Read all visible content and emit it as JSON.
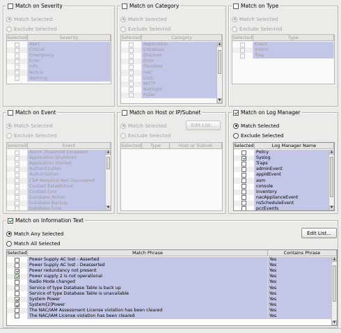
{
  "severity": {
    "title": "Match on Severity",
    "enabled": false,
    "match_selected": "Match Selected",
    "exclude_selected": "Exclude Selected",
    "col_selected": "Selected",
    "col_name": "Severity",
    "items": [
      "Alert",
      "Critical",
      "Emergency",
      "Error",
      "Info",
      "Notice",
      "Warning"
    ]
  },
  "category": {
    "title": "Match on Category",
    "enabled": false,
    "match_selected": "Match Selected",
    "exclude_selected": "Exclude Selected",
    "col_selected": "Selected",
    "col_name": "Category",
    "items": [
      "Application",
      "Database",
      "Discover",
      "Error",
      "FlexView",
      "HAC",
      "Lock",
      "MSTP",
      "NetSight",
      "Poller"
    ]
  },
  "type": {
    "title": "Match on Type",
    "enabled": false,
    "match_selected": "Match Selected",
    "exclude_selected": "Exclude Selected",
    "col_selected": "Selected",
    "col_name": "Type",
    "items": [
      "Event",
      "Inform",
      "Trap"
    ]
  },
  "event": {
    "title": "Match on Event",
    "enabled": false,
    "match_selected": "Match Selected",
    "exclude_selected": "Exclude Selected",
    "col_selected": "Selected",
    "col_name": "Event",
    "items": [
      "Alarm Threshold Exceeded",
      "Application Shutdown",
      "Application Started",
      "Authentication",
      "Authorization",
      "CDP Neighbor Not Discovered",
      "Contact Established",
      "Contact Lost",
      "Database Action",
      "Database Backup",
      "Database Error"
    ]
  },
  "host": {
    "title": "Match on Host or IP/Subnet",
    "enabled": false,
    "match_selected": "Match Selected",
    "exclude_selected": "Exclude Selected",
    "edit_list": "Edit List...",
    "col_selected": "Selected",
    "col_type": "Type",
    "col_host": "Host or Subnet"
  },
  "logmgr": {
    "title": "Match on Log Manager",
    "enabled": true,
    "match_selected": "Match Selected",
    "exclude_selected": "Exclude Selected",
    "col_selected": "Selected",
    "col_name": "Log Manager Name",
    "items": [
      {
        "name": "Policy",
        "checked": false
      },
      {
        "name": "Syslog",
        "checked": true
      },
      {
        "name": "Traps",
        "checked": false
      },
      {
        "name": "adminEvent",
        "checked": false
      },
      {
        "name": "appIdEvent",
        "checked": false
      },
      {
        "name": "asm",
        "checked": false
      },
      {
        "name": "console",
        "checked": false
      },
      {
        "name": "inventory",
        "checked": false
      },
      {
        "name": "nacApplianceEvent",
        "checked": false
      },
      {
        "name": "nsScheduleEvent",
        "checked": false
      },
      {
        "name": "pccEvents",
        "checked": false
      }
    ]
  },
  "info": {
    "title": "Match on Information Text",
    "enabled": true,
    "match_any": "Match Any Selected",
    "match_all": "Match All Selected",
    "edit_list": "Edit List...",
    "col_selected": "Selected",
    "col_phrase": "Match Phrase",
    "col_contains": "Contains Phrase",
    "rows": [
      {
        "phrase": "Power Supply AC lost  -  Asserted",
        "contains": "Yes",
        "checked": false
      },
      {
        "phrase": "Power Supply AC lost  -  Deasserted",
        "contains": "Yes",
        "checked": false
      },
      {
        "phrase": "Power redundancy not present",
        "contains": "Yes",
        "checked": true
      },
      {
        "phrase": "Power supply 2 is not operational",
        "contains": "Yes",
        "checked": true
      },
      {
        "phrase": "Radio Mode changed",
        "contains": "Yes",
        "checked": false
      },
      {
        "phrase": "Service of type Database Table is back up",
        "contains": "Yes",
        "checked": false
      },
      {
        "phrase": "Service of type Database Table is unavailable",
        "contains": "Yes",
        "checked": false
      },
      {
        "phrase": "System Power",
        "contains": "Yes",
        "checked": true
      },
      {
        "phrase": "System[2]Power",
        "contains": "Yes",
        "checked": true
      },
      {
        "phrase": "The NAC/IAM Assessment License violation has been cleared",
        "contains": "Yes",
        "checked": false
      },
      {
        "phrase": "The NAC/IAM License violation has been cleared",
        "contains": "Yes",
        "checked": false
      }
    ]
  },
  "colors": {
    "panel_bg": "#ecebe8",
    "list_highlight": "#c4c6e8",
    "check_green": "#2b7a2b"
  }
}
